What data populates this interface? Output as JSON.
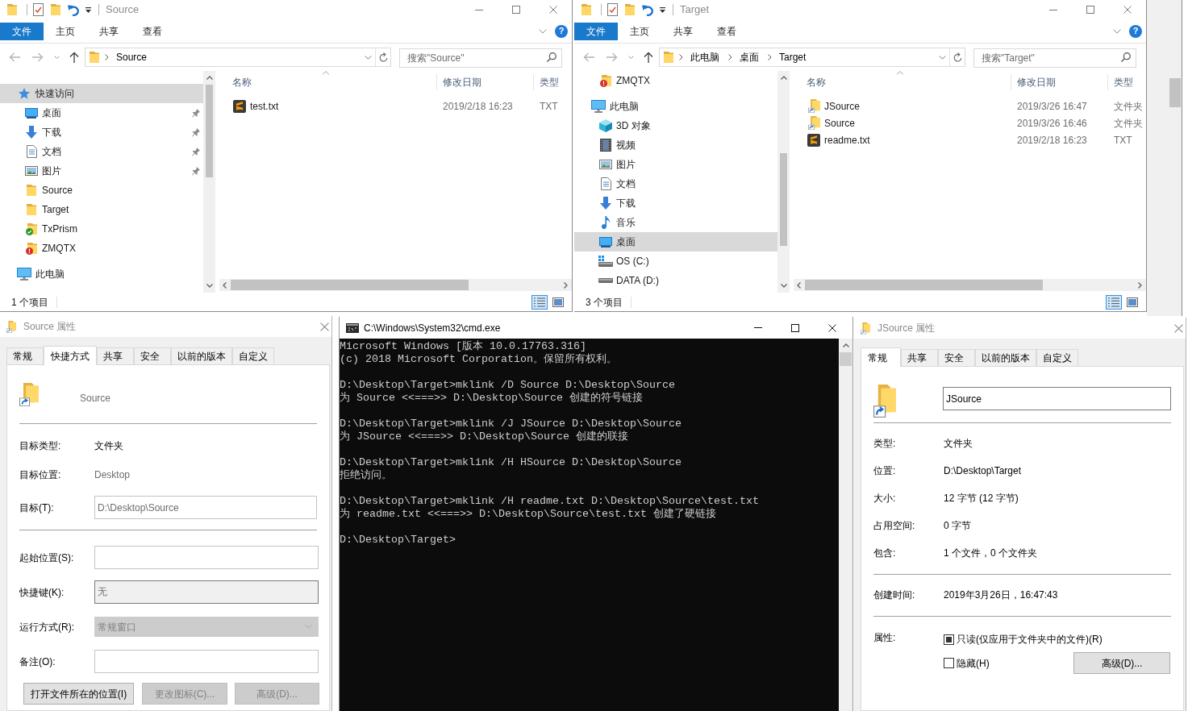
{
  "explorers": [
    {
      "title": "Source",
      "ribbon_tabs": [
        {
          "label": "文件",
          "selected": true
        },
        {
          "label": "主页",
          "selected": false
        },
        {
          "label": "共享",
          "selected": false
        },
        {
          "label": "查看",
          "selected": false
        }
      ],
      "help": "?",
      "address": [
        "Source"
      ],
      "search": {
        "placeholder": "搜索\"Source\""
      },
      "nav_pane": {
        "items": [
          {
            "label": "快速访问",
            "kind": "star",
            "selected": true,
            "children": [
              {
                "label": "桌面",
                "kind": "desktop",
                "pinned": true,
                "selected": false
              },
              {
                "label": "下载",
                "kind": "download",
                "pinned": true,
                "selected": false
              },
              {
                "label": "文档",
                "kind": "document",
                "pinned": true,
                "selected": false
              },
              {
                "label": "图片",
                "kind": "picture",
                "pinned": true,
                "selected": false
              },
              {
                "label": "Source",
                "kind": "folder",
                "pinned": false,
                "selected": false
              },
              {
                "label": "Target",
                "kind": "folder",
                "pinned": false,
                "selected": false
              },
              {
                "label": "TxPrism",
                "kind": "folder-ok",
                "pinned": false,
                "selected": false
              },
              {
                "label": "ZMQTX",
                "kind": "folder-error",
                "pinned": false,
                "selected": false
              }
            ]
          },
          {
            "label": "此电脑",
            "kind": "pc",
            "selected": false
          }
        ]
      },
      "columns": [
        {
          "label": "名称",
          "sorted": true
        },
        {
          "label": "修改日期",
          "sorted": false
        },
        {
          "label": "类型",
          "sorted": false
        }
      ],
      "files": [
        {
          "name": "test.txt",
          "kind": "text",
          "modified": "2019/2/18 16:23",
          "type": "TXT"
        }
      ],
      "status": "1 个项目",
      "views": [
        {
          "kind": "details",
          "selected": true
        },
        {
          "kind": "large-icons",
          "selected": false
        }
      ]
    },
    {
      "title": "Target",
      "ribbon_tabs": [
        {
          "label": "文件",
          "selected": true
        },
        {
          "label": "主页",
          "selected": false
        },
        {
          "label": "共享",
          "selected": false
        },
        {
          "label": "查看",
          "selected": false
        }
      ],
      "help": "?",
      "address": [
        "此电脑",
        "桌面",
        "Target"
      ],
      "search": {
        "placeholder": "搜索\"Target\""
      },
      "nav_pane": {
        "scrolled_items": [
          {
            "label": "ZMQTX",
            "kind": "folder-error",
            "pinned": false,
            "selected": false
          }
        ],
        "items": [
          {
            "label": "此电脑",
            "kind": "pc",
            "selected": false,
            "children": [
              {
                "label": "3D 对象",
                "kind": "cube",
                "selected": false
              },
              {
                "label": "视频",
                "kind": "video",
                "selected": false
              },
              {
                "label": "图片",
                "kind": "picture",
                "selected": false
              },
              {
                "label": "文档",
                "kind": "document",
                "selected": false
              },
              {
                "label": "下载",
                "kind": "download",
                "selected": false
              },
              {
                "label": "音乐",
                "kind": "music",
                "selected": false
              },
              {
                "label": "桌面",
                "kind": "desktop",
                "selected": true
              },
              {
                "label": "OS (C:)",
                "kind": "drive-os",
                "selected": false
              },
              {
                "label": "DATA (D:)",
                "kind": "drive",
                "selected": false
              }
            ]
          }
        ]
      },
      "columns": [
        {
          "label": "名称",
          "sorted": true
        },
        {
          "label": "修改日期",
          "sorted": false
        },
        {
          "label": "类型",
          "sorted": false
        }
      ],
      "files": [
        {
          "name": "JSource",
          "kind": "folder-shortcut",
          "modified": "2019/3/26 16:47",
          "type": "文件夹"
        },
        {
          "name": "Source",
          "kind": "folder-shortcut",
          "modified": "2019/3/26 16:46",
          "type": "文件夹"
        },
        {
          "name": "readme.txt",
          "kind": "text",
          "modified": "2019/2/18 16:23",
          "type": "TXT"
        }
      ],
      "status": "3 个项目",
      "views": [
        {
          "kind": "details",
          "selected": true
        },
        {
          "kind": "large-icons",
          "selected": false
        }
      ]
    }
  ],
  "shortcut_dialog": {
    "title": "Source 属性",
    "tabs": [
      {
        "label": "常规",
        "selected": false
      },
      {
        "label": "快捷方式",
        "selected": true
      },
      {
        "label": "共享",
        "selected": false
      },
      {
        "label": "安全",
        "selected": false
      },
      {
        "label": "以前的版本",
        "selected": false
      },
      {
        "label": "自定义",
        "selected": false
      }
    ],
    "name": "Source",
    "sections": [
      {
        "rows": [
          {
            "kind": "info",
            "label": "目标类型:",
            "value": "文件夹",
            "muted": false
          },
          {
            "kind": "info",
            "label": "目标位置:",
            "value": "Desktop",
            "muted": true
          },
          {
            "kind": "text",
            "label": "目标(T):",
            "value": "D:\\Desktop\\Source",
            "disabled": true
          }
        ]
      },
      {
        "rows": [
          {
            "kind": "text",
            "label": "起始位置(S):"
          },
          {
            "kind": "hotkey",
            "label": "快捷键(K):",
            "value": "无",
            "disabled": true
          },
          {
            "kind": "select",
            "label": "运行方式(R):",
            "value": "常规窗口",
            "disabled": true
          },
          {
            "kind": "text",
            "label": "备注(O):"
          }
        ]
      }
    ],
    "buttons": [
      {
        "label": "打开文件所在的位置(I)",
        "disabled": false
      },
      {
        "label": "更改图标(C)...",
        "disabled": true
      },
      {
        "label": "高级(D)...",
        "disabled": true
      }
    ]
  },
  "cmd": {
    "title": "C:\\Windows\\System32\\cmd.exe",
    "blocks": [
      {
        "lines": [
          "Microsoft Windows [版本 10.0.17763.316]",
          "(c) 2018 Microsoft Corporation。保留所有权利。"
        ]
      },
      {
        "lines": [
          "D:\\Desktop\\Target>mklink /D Source D:\\Desktop\\Source",
          "为 Source <<===>> D:\\Desktop\\Source 创建的符号链接"
        ]
      },
      {
        "lines": [
          "D:\\Desktop\\Target>mklink /J JSource D:\\Desktop\\Source",
          "为 JSource <<===>> D:\\Desktop\\Source 创建的联接"
        ]
      },
      {
        "lines": [
          "D:\\Desktop\\Target>mklink /H HSource D:\\Desktop\\Source",
          "拒绝访问。"
        ]
      },
      {
        "lines": [
          "D:\\Desktop\\Target>mklink /H readme.txt D:\\Desktop\\Source\\test.txt",
          "为 readme.txt <<===>> D:\\Desktop\\Source\\test.txt 创建了硬链接"
        ]
      },
      {
        "lines": [
          "D:\\Desktop\\Target>"
        ]
      }
    ]
  },
  "folder_dialog": {
    "title": "JSource 属性",
    "tabs": [
      {
        "label": "常规",
        "selected": true
      },
      {
        "label": "共享",
        "selected": false
      },
      {
        "label": "安全",
        "selected": false
      },
      {
        "label": "以前的版本",
        "selected": false
      },
      {
        "label": "自定义",
        "selected": false
      }
    ],
    "name": "JSource",
    "sections": [
      {
        "rows": [
          {
            "label": "类型:",
            "value": "文件夹"
          },
          {
            "label": "位置:",
            "value": "D:\\Desktop\\Target"
          },
          {
            "label": "大小:",
            "value": "12 字节 (12 字节)"
          },
          {
            "label": "占用空间:",
            "value": "0 字节"
          },
          {
            "label": "包含:",
            "value": "1 个文件，0 个文件夹"
          }
        ]
      },
      {
        "rows": [
          {
            "label": "创建时间:",
            "value": "2019年3月26日，16:47:43"
          }
        ]
      }
    ],
    "attributes": {
      "label": "属性:",
      "checkboxes": [
        {
          "label": "只读(仅应用于文件夹中的文件)(R)",
          "checked": false,
          "indeterminate": true
        },
        {
          "label": "隐藏(H)",
          "checked": false,
          "indeterminate": false
        }
      ],
      "button": "高级(D)..."
    }
  }
}
